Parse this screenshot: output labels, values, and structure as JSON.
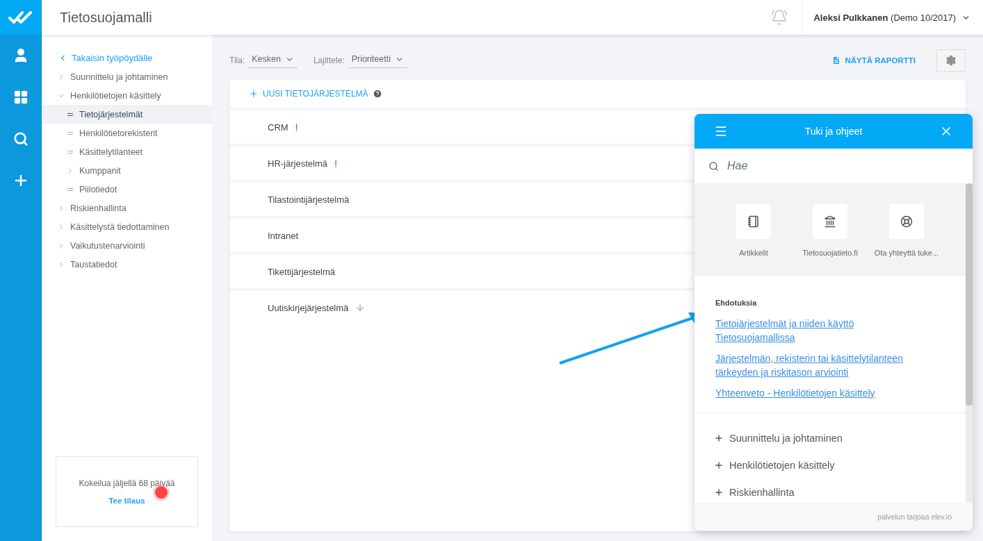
{
  "app": {
    "title": "Tietosuojamalli"
  },
  "user": {
    "name": "Aleksi Pulkkanen",
    "detail": "(Demo 10/2017)"
  },
  "sidebar": {
    "back": "Takaisin työpöydälle",
    "items": [
      {
        "label": "Suunnittelu ja johtaminen",
        "kind": "group",
        "expanded": false,
        "selected": false
      },
      {
        "label": "Henkilötietojen käsittely",
        "kind": "group",
        "expanded": true,
        "selected": false,
        "children": [
          {
            "label": "Tietojärjestelmät",
            "kind": "page",
            "selected": true
          },
          {
            "label": "Henkilötietorekisterit",
            "kind": "page",
            "selected": false
          },
          {
            "label": "Käsittelytilanteet",
            "kind": "page",
            "selected": false
          },
          {
            "label": "Kumppanit",
            "kind": "group",
            "expanded": false,
            "selected": false
          },
          {
            "label": "Piilotiedot",
            "kind": "page",
            "selected": false
          }
        ]
      },
      {
        "label": "Riskienhallinta",
        "kind": "group",
        "expanded": false,
        "selected": false
      },
      {
        "label": "Käsittelystä tiedottaminen",
        "kind": "group",
        "expanded": false,
        "selected": false
      },
      {
        "label": "Vaikutustenarviointi",
        "kind": "group",
        "expanded": false,
        "selected": false
      },
      {
        "label": "Taustatiedot",
        "kind": "group",
        "expanded": false,
        "selected": false
      }
    ]
  },
  "trial": {
    "text": "Kokeilua jäljellä 68 päivää",
    "link": "Tee tilaus"
  },
  "filters": [
    {
      "label": "Tila:",
      "value": "Kesken"
    },
    {
      "label": "Lajittele:",
      "value": "Prioriteetti"
    }
  ],
  "report_button": "NÄYTÄ RAPORTTI",
  "new_button": "UUSI TIETOJÄRJESTELMÄ",
  "systems": [
    {
      "name": "CRM",
      "flag": "!"
    },
    {
      "name": "HR-järjestelmä",
      "flag": "!"
    },
    {
      "name": "Tilastointijärjestelmä"
    },
    {
      "name": "Intranet"
    },
    {
      "name": "Tikettijärjestelmä"
    },
    {
      "name": "Uutiskirjejärjestelmä",
      "low_priority": true
    }
  ],
  "help": {
    "title": "Tuki ja ohjeet",
    "search_placeholder": "Hae",
    "shortcuts": [
      {
        "kind": "articles",
        "label": "Artikkelit"
      },
      {
        "kind": "website",
        "label": "Tietosuojatieto.fi"
      },
      {
        "kind": "support",
        "label": "Ota yhteyttä tuke..."
      }
    ],
    "suggestions_title": "Ehdotuksia",
    "suggestions": [
      "Tietojärjestelmät ja niiden käyttö Tietosuojamallissa",
      "Järjestelmän, rekisterin tai käsittelytilanteen tärkeyden ja riskitason arviointi",
      "Yhteenveto - Henkilötietojen käsittely"
    ],
    "categories": [
      "Suunnittelu ja johtaminen",
      "Henkilötietojen käsittely",
      "Riskienhallinta"
    ],
    "footer": "palvelun tarjoaa elev.io"
  }
}
